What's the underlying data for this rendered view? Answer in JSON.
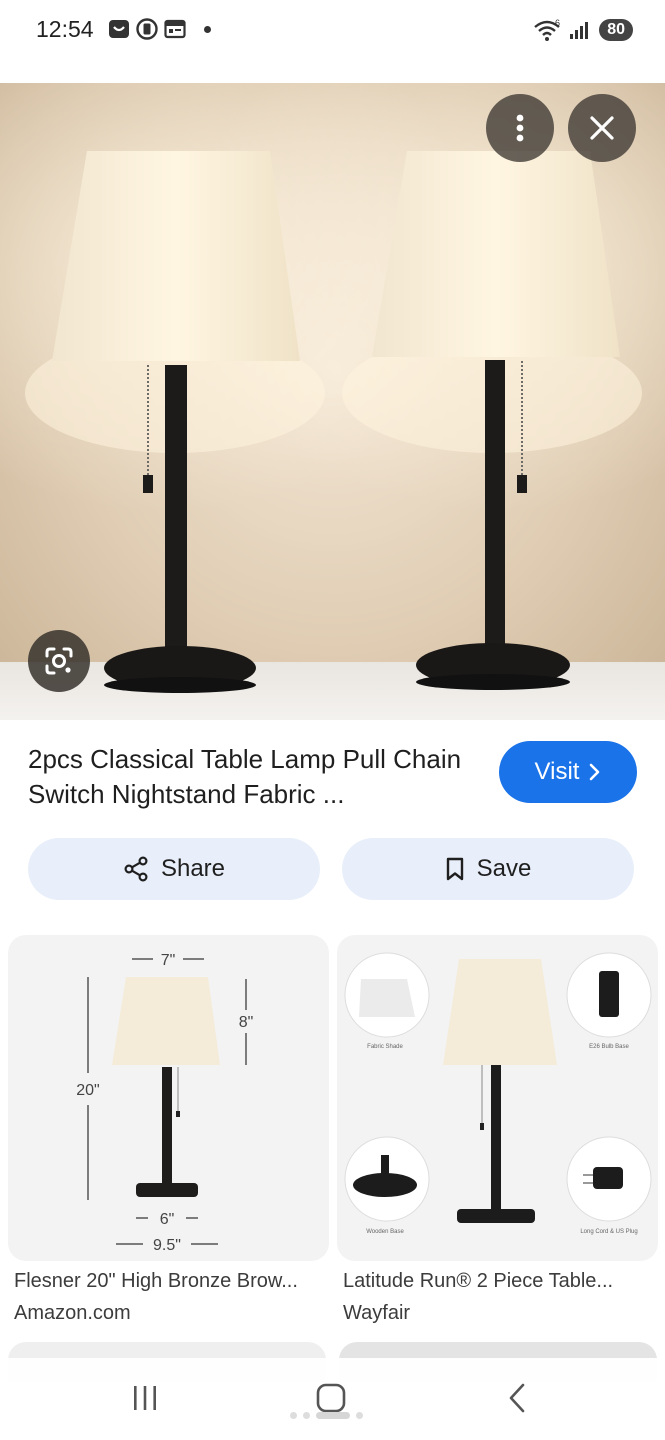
{
  "status_bar": {
    "time": "12:54",
    "battery": "80",
    "signal_label": "6"
  },
  "hero": {
    "more_icon": "more-vert-icon",
    "close_icon": "close-icon",
    "lens_icon": "google-lens-icon"
  },
  "product": {
    "title": "2pcs Classical Table Lamp Pull Chain Switch Nightstand Fabric ...",
    "visit_label": "Visit",
    "share_label": "Share",
    "save_label": "Save"
  },
  "results": [
    {
      "title": "Flesner 20\" High Bronze Brow...",
      "source": "Amazon.com",
      "dims": {
        "top": "7\"",
        "shade": "8\"",
        "height": "20\"",
        "base": "6\"",
        "bottom": "9.5\""
      }
    },
    {
      "title": "Latitude Run® 2 Piece Table...",
      "source": "Wayfair",
      "features": [
        "Fabric Shade",
        "E26 Bulb Base",
        "Wooden Base",
        "Long Cord & US Plug"
      ]
    }
  ],
  "colors": {
    "accent": "#1a73e8",
    "pill_bg": "#e8effa"
  }
}
